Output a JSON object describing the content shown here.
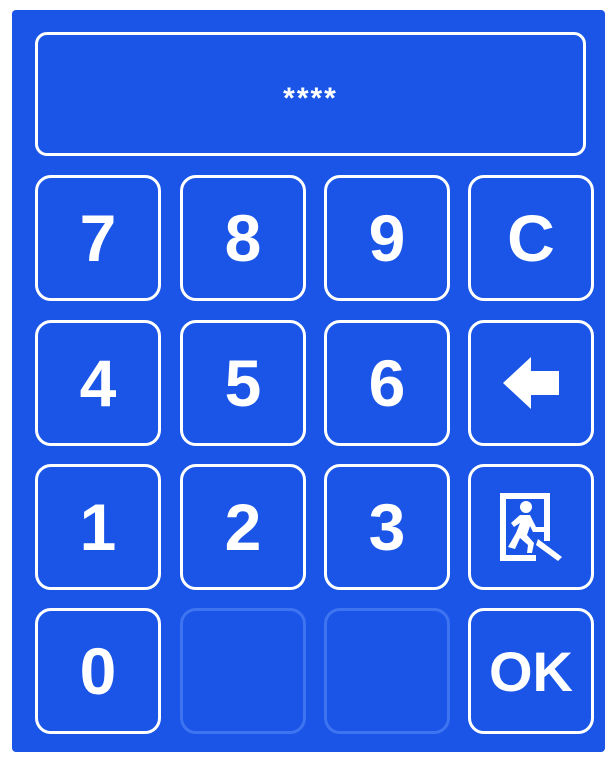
{
  "display": {
    "value": "****"
  },
  "keypad": {
    "row1": [
      "7",
      "8",
      "9",
      "C"
    ],
    "row2": [
      "4",
      "5",
      "6"
    ],
    "row3": [
      "1",
      "2",
      "3"
    ],
    "row4": {
      "zero": "0",
      "ok": "OK"
    },
    "icons": {
      "backspace": "arrow-left-icon",
      "exit": "emergency-exit-icon"
    }
  },
  "colors": {
    "panel_bg": "#1a55e8",
    "foreground": "#ffffff",
    "disabled_border": "#3f74f0"
  }
}
